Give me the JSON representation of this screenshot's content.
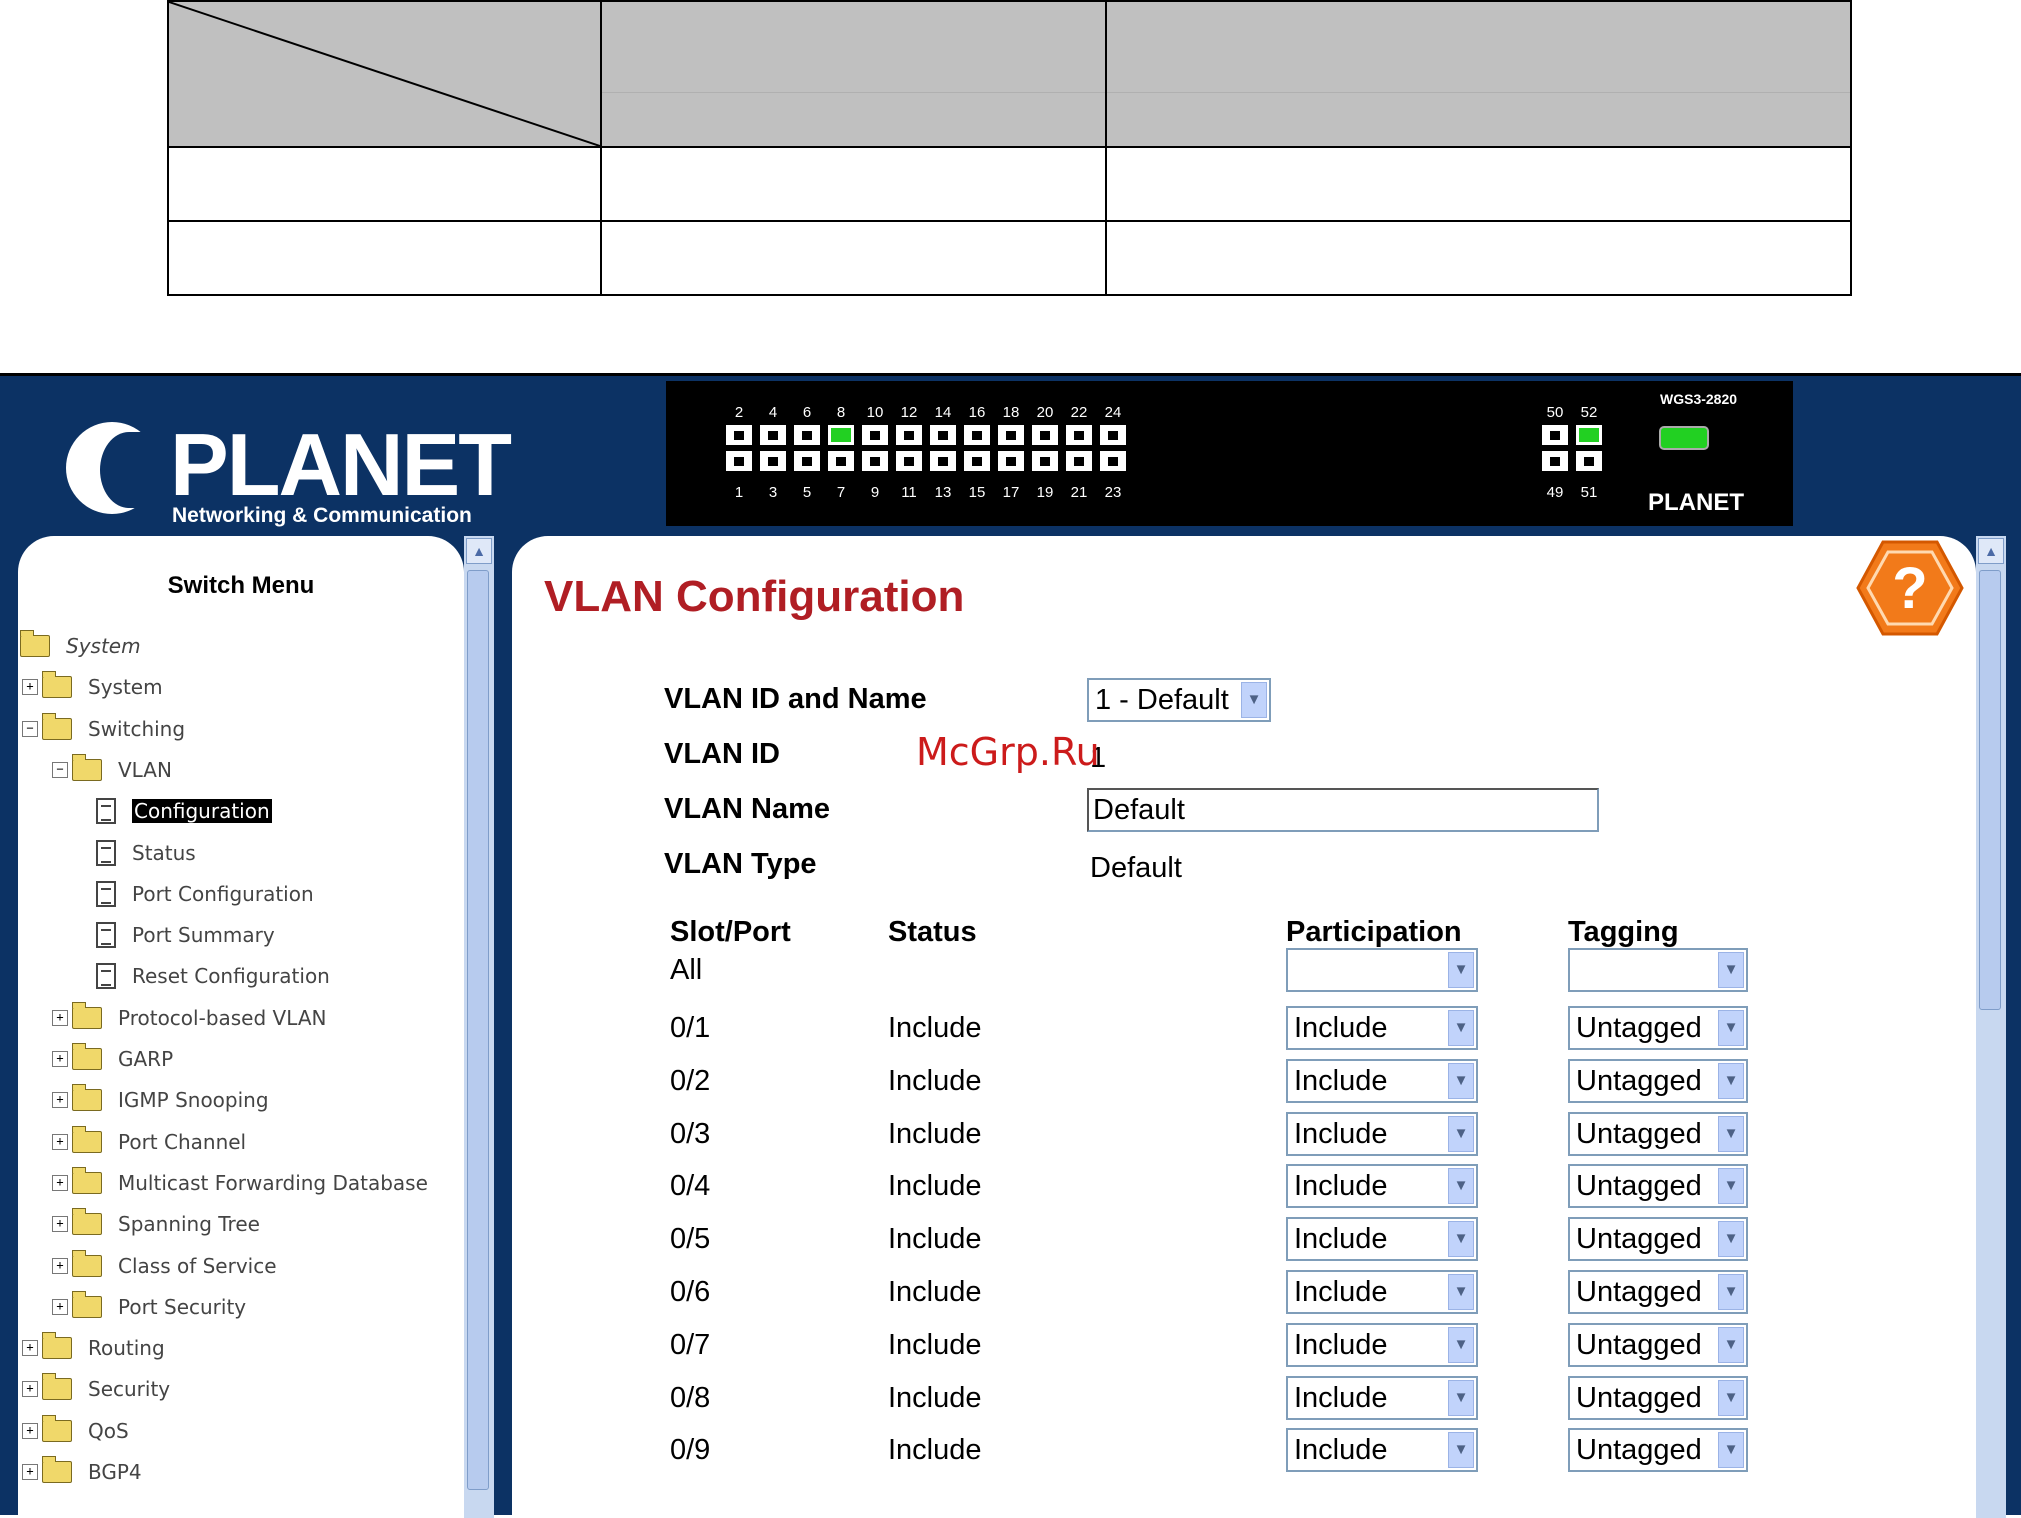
{
  "app": {
    "logo": {
      "name": "PLANET",
      "tagline": "Networking & Communication"
    },
    "panel": {
      "model": "WGS3-2820",
      "brand": "PLANET",
      "top_ports": [
        "2",
        "4",
        "6",
        "8",
        "10",
        "12",
        "14",
        "16",
        "18",
        "20",
        "22",
        "24"
      ],
      "bottom_ports": [
        "1",
        "3",
        "5",
        "7",
        "9",
        "11",
        "13",
        "15",
        "17",
        "19",
        "21",
        "23"
      ],
      "uplink_top": [
        "50",
        "52"
      ],
      "uplink_bottom": [
        "49",
        "51"
      ]
    },
    "menu": {
      "title": "Switch Menu",
      "items": [
        {
          "label": "System",
          "level": 0,
          "kind": "root"
        },
        {
          "label": "System",
          "level": 1,
          "kind": "folder",
          "expander": "+"
        },
        {
          "label": "Switching",
          "level": 1,
          "kind": "folder",
          "expander": "−"
        },
        {
          "label": "VLAN",
          "level": 2,
          "kind": "folder",
          "expander": "−"
        },
        {
          "label": "Configuration",
          "level": 3,
          "kind": "page",
          "selected": true
        },
        {
          "label": "Status",
          "level": 3,
          "kind": "page"
        },
        {
          "label": "Port Configuration",
          "level": 3,
          "kind": "page"
        },
        {
          "label": "Port Summary",
          "level": 3,
          "kind": "page"
        },
        {
          "label": "Reset Configuration",
          "level": 3,
          "kind": "page"
        },
        {
          "label": "Protocol-based VLAN",
          "level": 2,
          "kind": "folder",
          "expander": "+"
        },
        {
          "label": "GARP",
          "level": 2,
          "kind": "folder",
          "expander": "+"
        },
        {
          "label": "IGMP Snooping",
          "level": 2,
          "kind": "folder",
          "expander": "+"
        },
        {
          "label": "Port Channel",
          "level": 2,
          "kind": "folder",
          "expander": "+"
        },
        {
          "label": "Multicast Forwarding Database",
          "level": 2,
          "kind": "folder",
          "expander": "+"
        },
        {
          "label": "Spanning Tree",
          "level": 2,
          "kind": "folder",
          "expander": "+"
        },
        {
          "label": "Class of Service",
          "level": 2,
          "kind": "folder",
          "expander": "+"
        },
        {
          "label": "Port Security",
          "level": 2,
          "kind": "folder",
          "expander": "+"
        },
        {
          "label": "Routing",
          "level": 1,
          "kind": "folder",
          "expander": "+"
        },
        {
          "label": "Security",
          "level": 1,
          "kind": "folder",
          "expander": "+"
        },
        {
          "label": "QoS",
          "level": 1,
          "kind": "folder",
          "expander": "+"
        },
        {
          "label": "BGP4",
          "level": 1,
          "kind": "folder",
          "expander": "+"
        }
      ]
    },
    "main": {
      "title": "VLAN Configuration",
      "watermark": "McGrp.Ru",
      "vlan_id_name_label": "VLAN ID and Name",
      "vlan_id_name_value": "1 - Default",
      "vlan_id_label": "VLAN ID",
      "vlan_id_value": "1",
      "vlan_name_label": "VLAN Name",
      "vlan_name_value": "Default",
      "vlan_type_label": "VLAN Type",
      "vlan_type_value": "Default",
      "columns": {
        "slot_port": "Slot/Port",
        "status": "Status",
        "participation": "Participation",
        "tagging": "Tagging"
      },
      "all_row": {
        "slot_port": "All",
        "participation": "",
        "tagging": ""
      },
      "rows": [
        {
          "slot_port": "0/1",
          "status": "Include",
          "participation": "Include",
          "tagging": "Untagged"
        },
        {
          "slot_port": "0/2",
          "status": "Include",
          "participation": "Include",
          "tagging": "Untagged"
        },
        {
          "slot_port": "0/3",
          "status": "Include",
          "participation": "Include",
          "tagging": "Untagged"
        },
        {
          "slot_port": "0/4",
          "status": "Include",
          "participation": "Include",
          "tagging": "Untagged"
        },
        {
          "slot_port": "0/5",
          "status": "Include",
          "participation": "Include",
          "tagging": "Untagged"
        },
        {
          "slot_port": "0/6",
          "status": "Include",
          "participation": "Include",
          "tagging": "Untagged"
        },
        {
          "slot_port": "0/7",
          "status": "Include",
          "participation": "Include",
          "tagging": "Untagged"
        },
        {
          "slot_port": "0/8",
          "status": "Include",
          "participation": "Include",
          "tagging": "Untagged"
        },
        {
          "slot_port": "0/9",
          "status": "Include",
          "participation": "Include",
          "tagging": "Untagged"
        }
      ]
    }
  }
}
